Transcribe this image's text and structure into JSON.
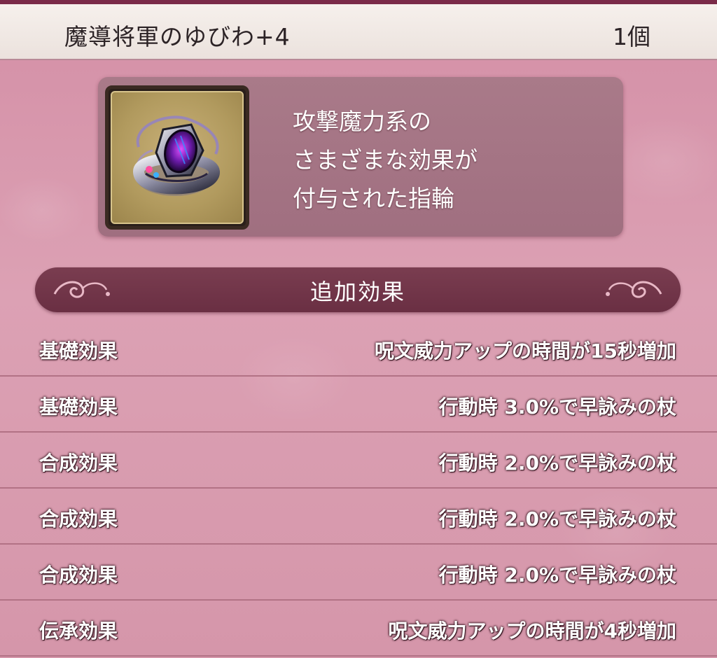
{
  "header": {
    "item_name": "魔導将軍のゆびわ+4",
    "count": "1個"
  },
  "item": {
    "icon": "ring-icon",
    "description": [
      "攻撃魔力系の",
      "さまざまな効果が",
      "付与された指輪"
    ]
  },
  "section": {
    "title": "追加効果"
  },
  "effects": [
    {
      "label": "基礎効果",
      "value": "呪文威力アップの時間が15秒増加"
    },
    {
      "label": "基礎効果",
      "value": "行動時 3.0%で早詠みの杖"
    },
    {
      "label": "合成効果",
      "value": "行動時 2.0%で早詠みの杖"
    },
    {
      "label": "合成効果",
      "value": "行動時 2.0%で早詠みの杖"
    },
    {
      "label": "合成効果",
      "value": "行動時 2.0%で早詠みの杖"
    },
    {
      "label": "伝承効果",
      "value": "呪文威力アップの時間が4秒増加"
    }
  ],
  "colors": {
    "accent": "#6a2f43",
    "background": "#d89aad",
    "header": "#f3ede9"
  }
}
